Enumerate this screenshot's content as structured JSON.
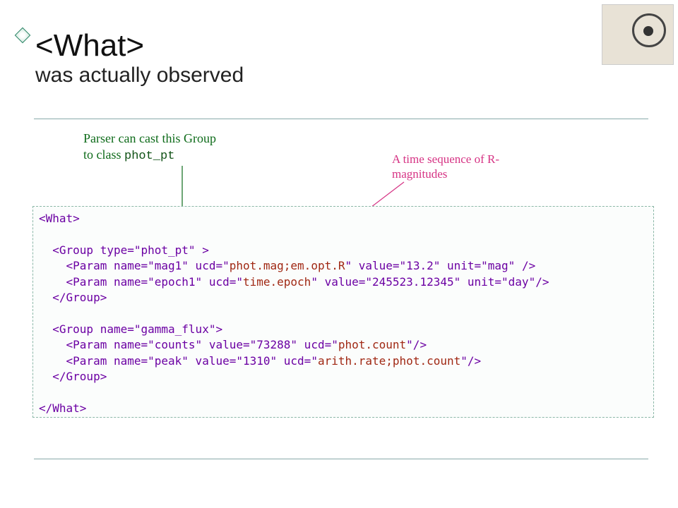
{
  "title": {
    "line1": "<What>",
    "line2": "was actually observed"
  },
  "callouts": {
    "green_line1": "Parser can cast this Group",
    "green_line2_prefix": "to class ",
    "green_line2_mono": "phot_pt",
    "pink_line1": "A time sequence of R-",
    "pink_line2": "magnitudes"
  },
  "code": {
    "what_open": "<What>",
    "group1_open": "<Group type=\"phot_pt\" >",
    "param_mag": "<Param name=\"mag1\" ucd=\"phot.mag;em.opt.R\" value=\"13.2\" unit=\"mag\" />",
    "param_mag_ucd": "phot.mag;em.opt.R",
    "param_epoch": "<Param name=\"epoch1\" ucd=\"time.epoch\" value=\"245523.12345\" unit=\"day\"/>",
    "param_epoch_ucd": "time.epoch",
    "group_close": "</Group>",
    "group2_open": "<Group name=\"gamma_flux\">",
    "param_counts": "<Param name=\"counts\" value=\"73288\" ucd=\"phot.count\"/>",
    "param_counts_ucd": "phot.count",
    "param_peak": "<Param name=\"peak\" value=\"1310\" ucd=\"arith.rate;phot.count\"/>",
    "param_peak_ucd": "arith.rate;phot.count",
    "what_close": "</What>"
  }
}
